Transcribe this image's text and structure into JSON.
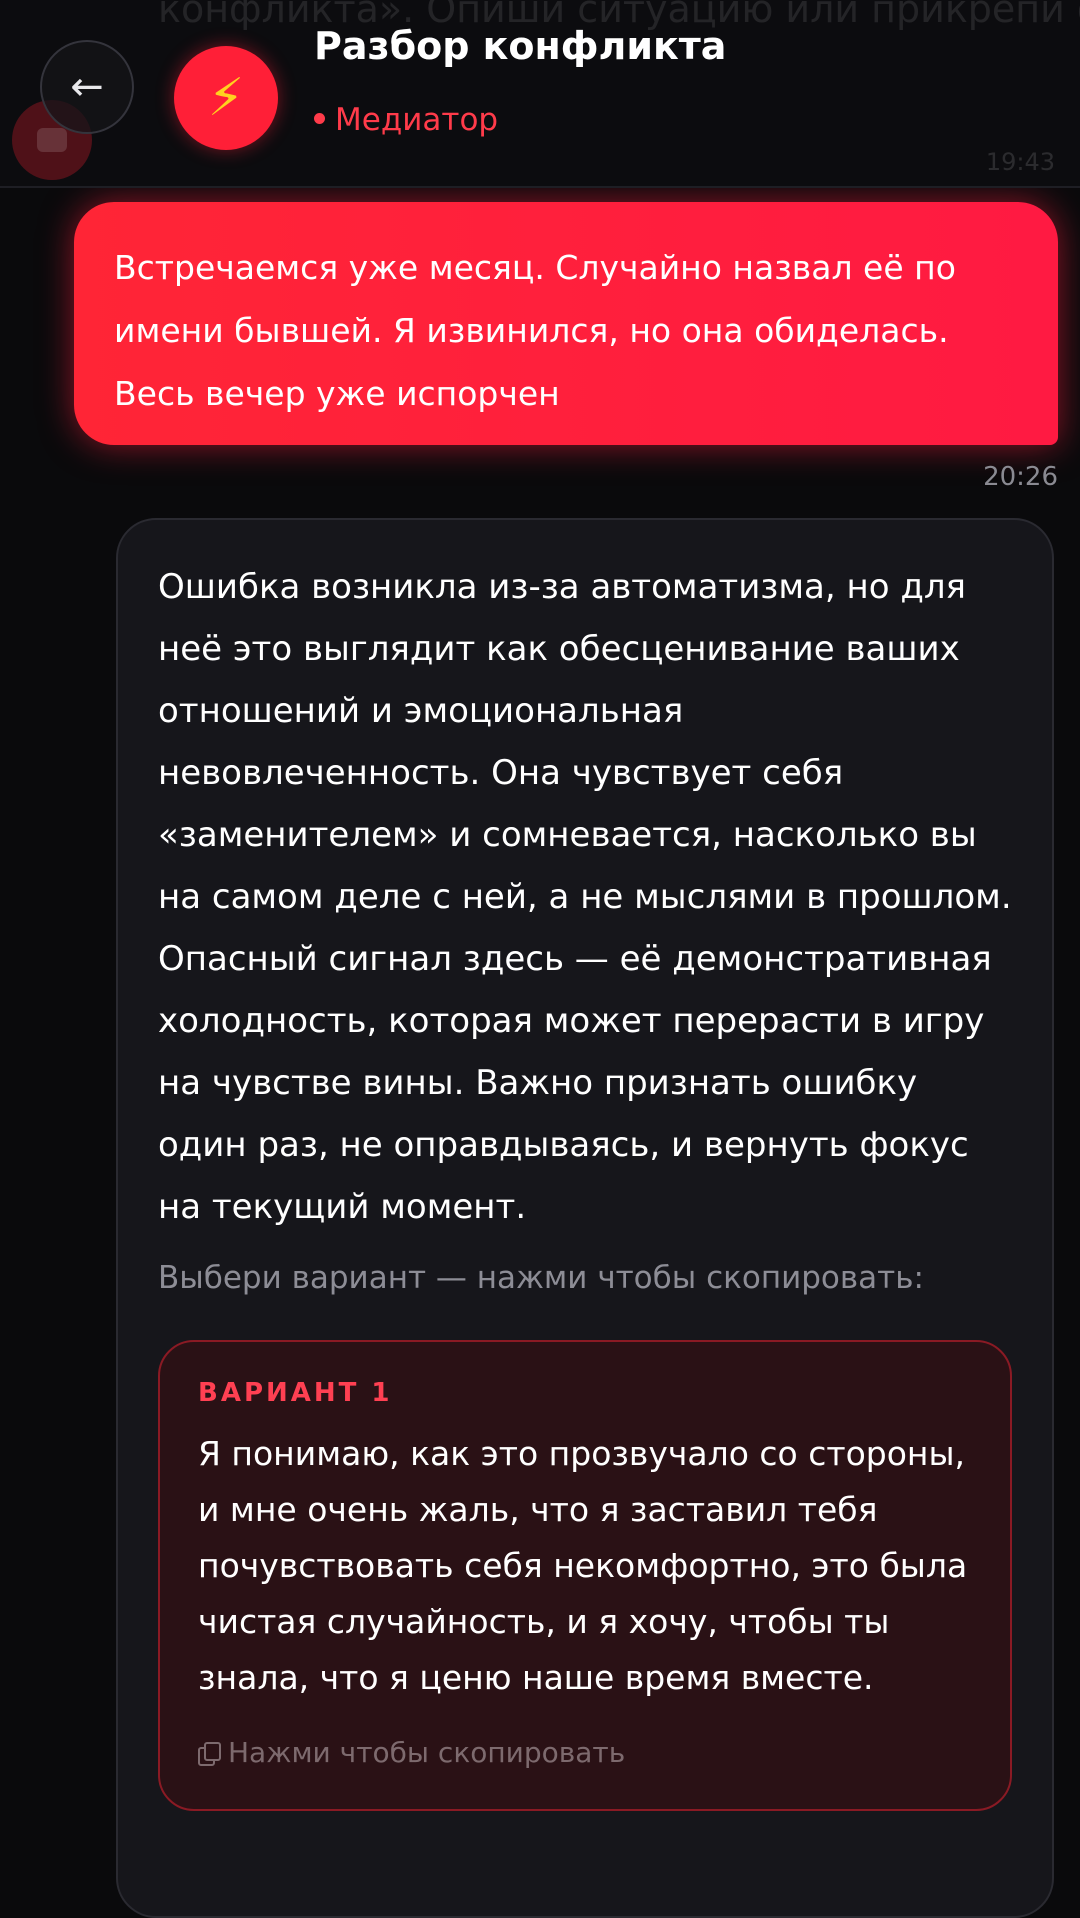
{
  "header": {
    "title": "Разбор конфликта",
    "status": "Медиатор",
    "bot_icon": "⚡",
    "back_icon": "←",
    "background_preview": {
      "text": "конфликта». Опиши ситуацию или прикрепи ф",
      "time": "19:43"
    }
  },
  "messages": {
    "user": {
      "text": "Встречаемся уже месяц. Случайно назвал её по имени бывшей. Я извинился, но она обиделась. Весь вечер уже испорчен",
      "time": "20:26"
    },
    "bot": {
      "text": "Ошибка возникла из-за автоматизма, но для неё это выглядит как обесценивание ваших отношений и эмоциональная невовлеченность. Она чувствует себя «заменителем» и сомневается, насколько вы на самом деле с ней, а не мыслями в прошлом. Опасный сигнал здесь — её демонстративная холодность, которая может перерасти в игру на чувстве вины. Важно признать ошибку один раз, не оправдываясь, и вернуть фокус на текущий момент.",
      "hint": "Выбери вариант — нажми чтобы скопировать:",
      "variants": [
        {
          "label": "ВАРИАНТ 1",
          "text": "Я понимаю, как это прозвучало со стороны, и мне очень жаль, что я заставил тебя почувствовать себя некомфортно, это была чистая случайность, и я хочу, чтобы ты знала, что я ценю наше время вместе.",
          "copy_label": "Нажми чтобы скопировать"
        }
      ]
    }
  },
  "colors": {
    "accent": "#ff1f37",
    "status": "#ff3b4a",
    "bolt": "#ffd21f",
    "background": "#0a0a0c",
    "bot_bubble": "#16161b",
    "variant_card": "#2a1115"
  }
}
